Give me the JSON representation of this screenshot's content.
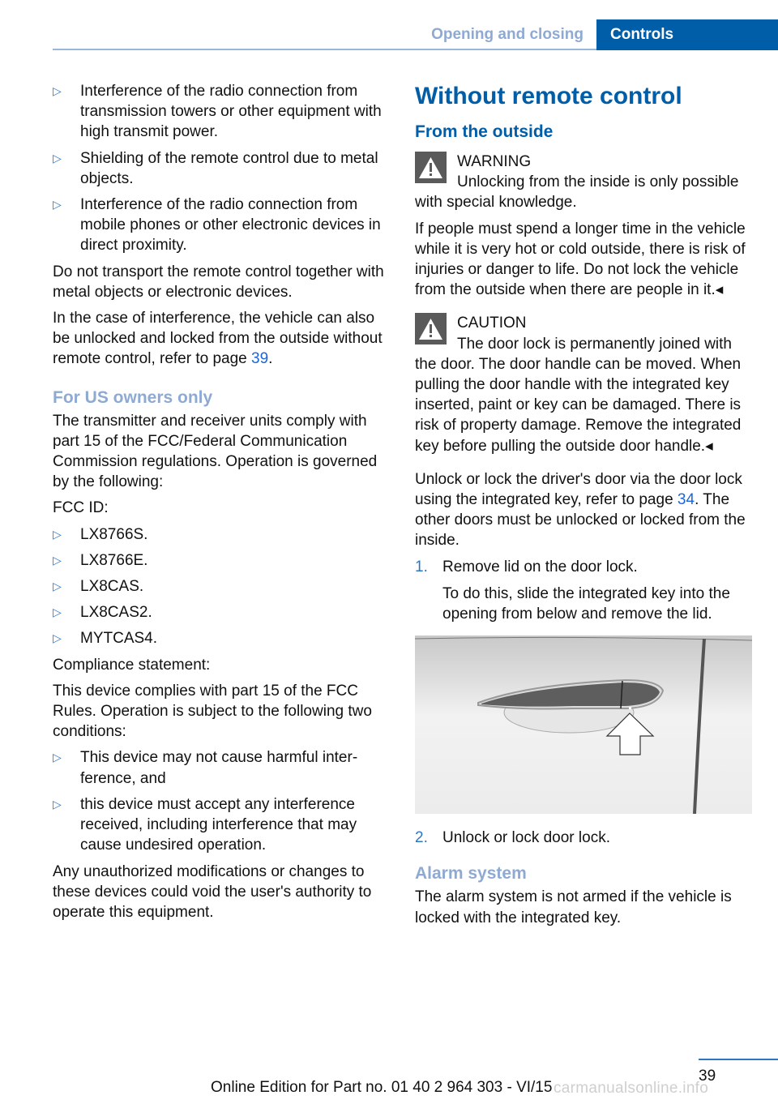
{
  "header": {
    "section": "Opening and closing",
    "chapter": "Controls"
  },
  "left_column": {
    "interference_bullets": [
      "Interference of the radio connection from transmission towers or other equipment with high transmit power.",
      "Shielding of the remote control due to metal objects.",
      "Interference of the radio connection from mobile phones or other electronic devices in direct proximity."
    ],
    "para_transport": "Do not transport the remote control together with metal objects or electronic devices.",
    "para_interference_before": "In the case of interference, the vehicle can also be unlocked and locked from the outside with­out remote control, refer to page ",
    "para_interference_link": "39",
    "para_interference_after": ".",
    "us_heading": "For US owners only",
    "us_para": "The transmitter and receiver units comply with part 15 of the FCC/Federal Communication Commission regulations. Operation is gov­erned by the following:",
    "fcc_label": "FCC ID:",
    "fcc_ids": [
      "LX8766S.",
      "LX8766E.",
      "LX8CAS.",
      "LX8CAS2.",
      "MYTCAS4."
    ],
    "compliance_label": "Compliance statement:",
    "compliance_para": "This device complies with part 15 of the FCC Rules. Operation is subject to the following two conditions:",
    "conditions": [
      "This device may not cause harmful inter­ference, and",
      "this device must accept any interference received, including interference that may cause undesired operation."
    ],
    "modifications_para": "Any unauthorized modifications or changes to these devices could void the user's authority to operate this equipment."
  },
  "right_column": {
    "main_heading": "Without remote control",
    "sub_heading": "From the outside",
    "warning": {
      "title": "WARNING",
      "text1": "Unlocking from the inside is only possi­ble with special knowledge.",
      "text2": "If people must spend a longer time in the vehi­cle while it is very hot or cold outside, there is risk of injuries or danger to life. Do not lock the vehicle from the outside when there are people in it.◂"
    },
    "caution": {
      "title": "CAUTION",
      "text": "The door lock is permanently joined with the door. The door handle can be moved. When pulling the door handle with the integrated key inserted, paint or key can be damaged. There is risk of property damage. Remove the integrated key before pulling the outside door handle.◂"
    },
    "unlock_para_before": "Unlock or lock the driver's door via the door lock using the integrated key, refer to page ",
    "unlock_para_link": "34",
    "unlock_para_after": ". The other doors must be unlocked or locked from the inside.",
    "steps": [
      {
        "num": "1.",
        "text": "Remove lid on the door lock.",
        "detail": "To do this, slide the integrated key into the opening from below and remove the lid."
      },
      {
        "num": "2.",
        "text": "Unlock or lock door lock."
      }
    ],
    "figure_alt": "Door handle with arrow pointing to door lock cover",
    "alarm_heading": "Alarm system",
    "alarm_para": "The alarm system is not armed if the vehicle is locked with the integrated key."
  },
  "footer": {
    "page_number": "39",
    "edition": "Online Edition for Part no. 01 40 2 964 303 - VI/15",
    "watermark": "carmanualsonline.info"
  },
  "colors": {
    "brand_blue": "#005ea8",
    "light_blue": "#8eaad3",
    "link_blue": "#1a66d8",
    "icon_gray": "#5a5a5a"
  }
}
